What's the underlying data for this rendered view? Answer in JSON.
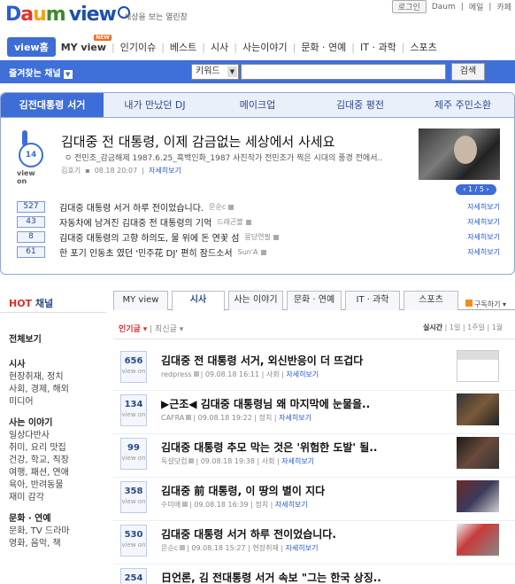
{
  "header": {
    "logo": "Daum",
    "logo_sub": "view",
    "tagline": "세상을 보는 열린창",
    "links": [
      "로그인",
      "Daum",
      "메일",
      "카페"
    ]
  },
  "gnb": {
    "items": [
      {
        "label": "view홈",
        "active": true
      },
      {
        "label": "MY view",
        "bold": true,
        "badge": "NEW"
      },
      {
        "label": "인기이슈"
      },
      {
        "label": "베스트"
      },
      {
        "label": "시사"
      },
      {
        "label": "사는이야기"
      },
      {
        "label": "문화 · 연예"
      },
      {
        "label": "IT · 과학"
      },
      {
        "label": "스포츠"
      }
    ]
  },
  "search": {
    "channel_label": "즐겨찾는 채널",
    "keyword_select": "키워드",
    "button_label": "검색",
    "value": ""
  },
  "featured": {
    "tabs": [
      "김전대통령 서거",
      "내가 만났던 DJ",
      "메이크업",
      "김대중 평전",
      "제주 주민소환"
    ],
    "active_tab": 0,
    "view_count": "14",
    "view_on_label": "view on",
    "title": "김대중 전 대통령, 이제 감금없는 세상에서 사세요",
    "desc": "ㅇ 전민조_감금해제 1987.6.25_흑백인화_1987 사진작가 전민조가 찍은 시대의 풍경 전에서..",
    "author": "김호기",
    "date": "08.18 20:07",
    "more_label": "자세히보기",
    "pager": "1 / 5",
    "list": [
      {
        "count": "527",
        "title": "김대중 대통령 서거 하루 전이었습니다.",
        "author": "문순c",
        "more": "자세히보기"
      },
      {
        "count": "43",
        "title": "자동차에 남겨진 김대중 전 대통령의 기억",
        "author": "드래곤볼",
        "more": "자세히보기"
      },
      {
        "count": "8",
        "title": "김대중 대통령의 고향 하의도, 물 위에 돈 연꽃 섬",
        "author": "몽당연필",
        "more": "자세히보기"
      },
      {
        "count": "61",
        "title": "한 포기 인동초 였던 '민주花 DJ' 편히 잠드소서",
        "author": "Sun'A",
        "more": "자세히보기"
      }
    ]
  },
  "left_nav": {
    "hot_prefix": "HOT",
    "hot_suffix": " 채널",
    "all": "전체보기",
    "groups": [
      {
        "head": "시사",
        "items": [
          "현장취재, 정치",
          "사회, 경제, 해외",
          "미디어"
        ]
      },
      {
        "head": "사는 이야기",
        "items": [
          "일상다반사",
          "취미, 요리 맛집",
          "건강, 학교, 직장",
          "여행, 패션, 연애",
          "육아, 반려동물",
          "재미 감각"
        ]
      },
      {
        "head": "문화 · 연예",
        "items": [
          "문화, TV 드라마",
          "영화, 음악, 책"
        ]
      }
    ]
  },
  "main": {
    "tabs": [
      "MY view",
      "시사",
      "사는 이야기",
      "문화 · 연예",
      "IT · 과학",
      "스포츠"
    ],
    "active_tab": 1,
    "rss_label": "구독하기",
    "sort_popular": "인기글",
    "sort_latest": "최신글",
    "period_label": "실시간",
    "period_opts": [
      "1일",
      "1주일",
      "1월"
    ],
    "view_on_label": "view on",
    "articles": [
      {
        "count": "656",
        "title": "김대중 전 대통령 서거, 외신반응이 더 뜨겁다",
        "author": "redpress",
        "date": "09.08.18 16:11",
        "category": "사회",
        "more": "자세히보기"
      },
      {
        "count": "134",
        "title": "▶근조◀ 김대중 대통령님 왜 마지막에 눈물을..",
        "author": "CAFRA",
        "date": "09.08.18 19:22",
        "category": "정치",
        "more": "자세히보기"
      },
      {
        "count": "99",
        "title": "김대중 대통령 추모 막는 것은 '위험한 도발' 될..",
        "author": "독설닷컴",
        "date": "09.08.18 19:38",
        "category": "사회",
        "more": "자세히보기"
      },
      {
        "count": "358",
        "title": "김대중 前 대통령, 이 땅의 별이 지다",
        "author": "수미애",
        "date": "09.08.18 16:39",
        "category": "정치",
        "more": "자세히보기"
      },
      {
        "count": "530",
        "title": "김대중 대통령 서거 하루 전이었습니다.",
        "author": "문순c",
        "date": "09.08.18 15:27",
        "category": "현장취재",
        "more": "자세히보기"
      },
      {
        "count": "254",
        "title": "日언론, 김 전대통령 서거 속보 \"그는 한국 상징..",
        "author": "",
        "date": "",
        "category": "",
        "more": ""
      }
    ]
  },
  "colors": {
    "brand_blue": "#3d6dd6",
    "accent_red": "#d9302a"
  }
}
